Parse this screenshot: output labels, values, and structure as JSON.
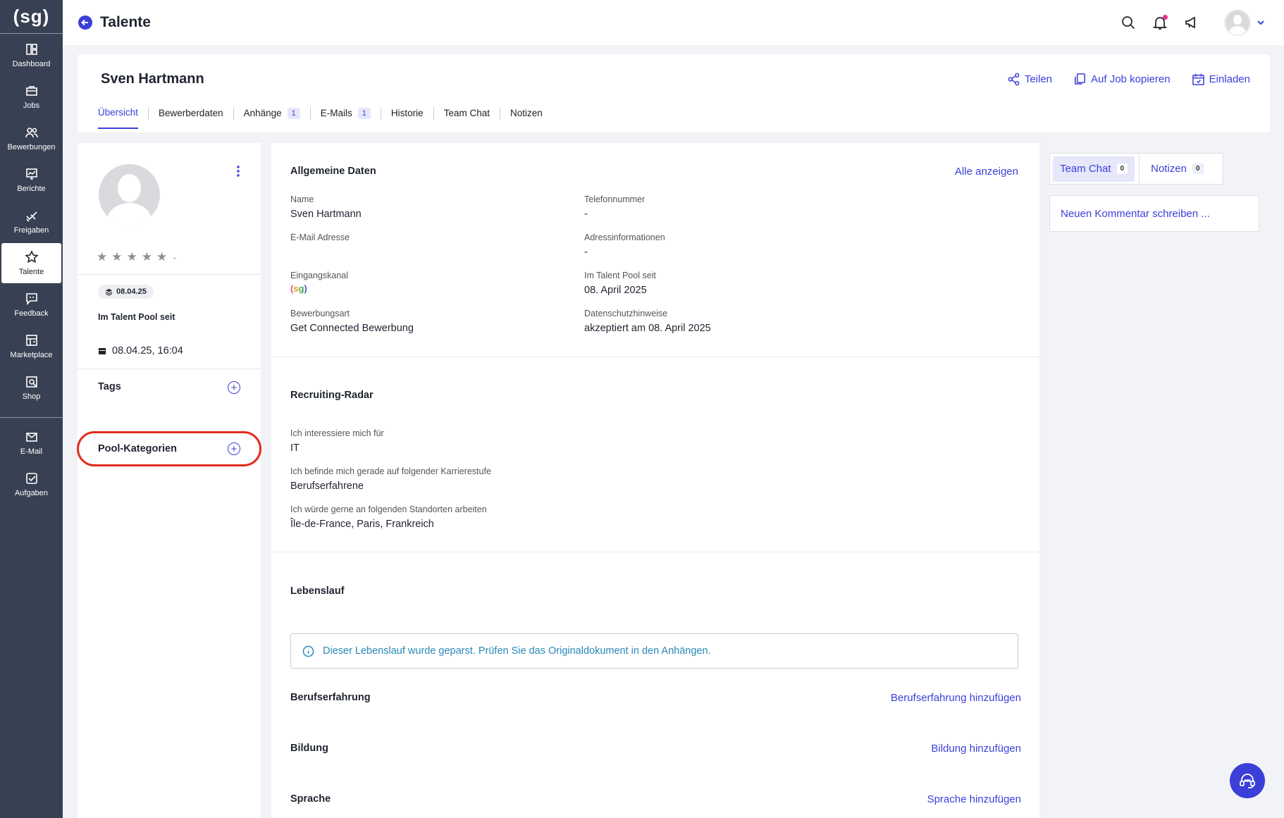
{
  "sidebar": {
    "logo": "(sg)",
    "items": [
      {
        "label": "Dashboard",
        "icon": "dashboard-icon"
      },
      {
        "label": "Jobs",
        "icon": "briefcase-icon"
      },
      {
        "label": "Bewerbungen",
        "icon": "users-icon"
      },
      {
        "label": "Berichte",
        "icon": "chart-icon"
      },
      {
        "label": "Freigaben",
        "icon": "approval-icon"
      },
      {
        "label": "Talente",
        "icon": "star-icon",
        "active": true
      },
      {
        "label": "Feedback",
        "icon": "feedback-icon"
      },
      {
        "label": "Marketplace",
        "icon": "store-icon"
      },
      {
        "label": "Shop",
        "icon": "shop-icon"
      }
    ],
    "bottom_items": [
      {
        "label": "E-Mail",
        "icon": "mail-icon"
      },
      {
        "label": "Aufgaben",
        "icon": "tasks-icon"
      }
    ]
  },
  "header": {
    "title": "Talente"
  },
  "candidate": {
    "name": "Sven Hartmann",
    "actions": {
      "share": "Teilen",
      "copy": "Auf Job kopieren",
      "invite": "Einladen"
    },
    "tabs": [
      {
        "label": "Übersicht",
        "active": true
      },
      {
        "label": "Bewerberdaten"
      },
      {
        "label": "Anhänge",
        "count": "1"
      },
      {
        "label": "E-Mails",
        "count": "1"
      },
      {
        "label": "Historie"
      },
      {
        "label": "Team Chat"
      },
      {
        "label": "Notizen"
      }
    ]
  },
  "profile": {
    "rating_text": "-",
    "badge_date": "08.04.25",
    "pool_label": "Im Talent Pool seit",
    "datetime": "08.04.25, 16:04",
    "tags_title": "Tags",
    "pool_categories_title": "Pool-Kategorien"
  },
  "general": {
    "title": "Allgemeine Daten",
    "show_all": "Alle anzeigen",
    "fields": {
      "name_label": "Name",
      "name_value": "Sven Hartmann",
      "phone_label": "Telefonnummer",
      "phone_value": "-",
      "email_label": "E-Mail Adresse",
      "address_label": "Adressinformationen",
      "address_value": "-",
      "channel_label": "Eingangskanal",
      "channel_logo": "(sg)",
      "pool_since_label": "Im Talent Pool seit",
      "pool_since_value": "08. April 2025",
      "apptype_label": "Bewerbungsart",
      "apptype_value": "Get Connected Bewerbung",
      "privacy_label": "Datenschutzhinweise",
      "privacy_value": "akzeptiert am 08. April 2025"
    }
  },
  "radar": {
    "title": "Recruiting-Radar",
    "q1": "Ich interessiere mich für",
    "a1": "IT",
    "q2": "Ich befinde mich gerade auf folgender Karrierestufe",
    "a2": "Berufserfahrene",
    "q3": "Ich würde gerne an folgenden Standorten arbeiten",
    "a3": "Île-de-France, Paris, Frankreich"
  },
  "cv": {
    "title": "Lebenslauf",
    "info": "Dieser Lebenslauf wurde geparst. Prüfen Sie das Originaldokument in den Anhängen.",
    "experience": "Berufserfahrung",
    "experience_add": "Berufserfahrung hinzufügen",
    "education": "Bildung",
    "education_add": "Bildung hinzufügen",
    "language": "Sprache",
    "language_add": "Sprache hinzufügen"
  },
  "right_panel": {
    "team_chat": "Team Chat",
    "team_chat_count": "0",
    "notes": "Notizen",
    "notes_count": "0",
    "comment_placeholder": "Neuen Kommentar schreiben ..."
  },
  "colors": {
    "accent": "#3b3fd8",
    "sidebar": "#384153",
    "highlight": "#e12d1e",
    "info": "#2a88b8"
  }
}
